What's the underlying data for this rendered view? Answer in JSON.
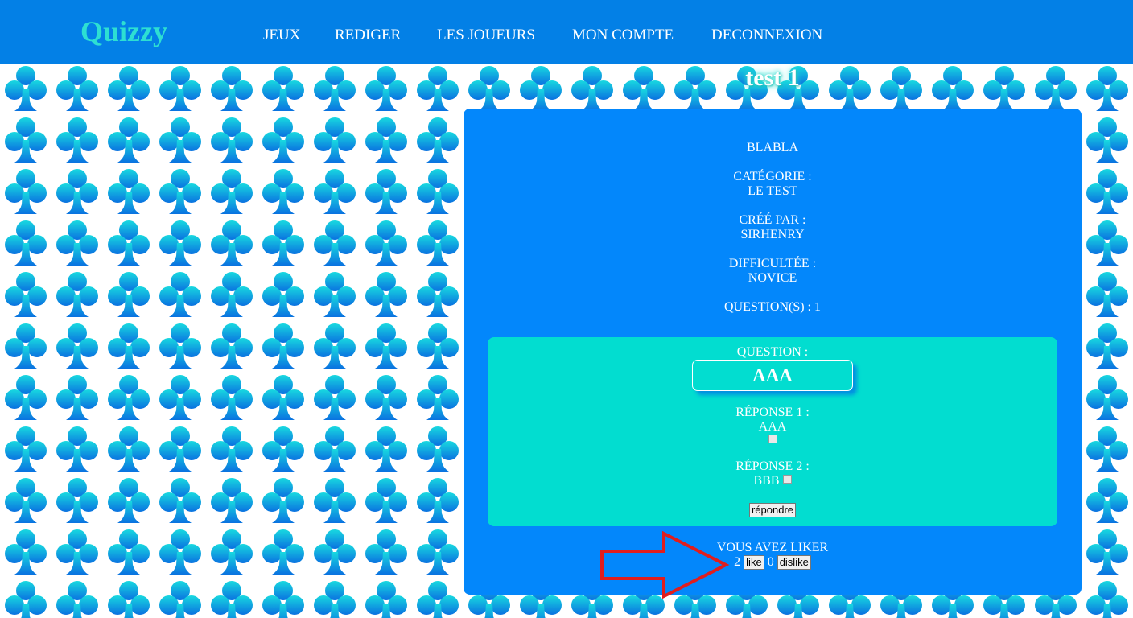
{
  "app": {
    "brand": "Quizzy"
  },
  "nav": {
    "items": [
      {
        "label": "JEUX"
      },
      {
        "label": "REDIGER"
      },
      {
        "label": "LES JOUEURS"
      },
      {
        "label": "MON COMPTE"
      },
      {
        "label": "DECONNEXION"
      }
    ]
  },
  "colors": {
    "navbar": "#0380e6",
    "brand": "#2ddfd2",
    "card": "#0387fb",
    "question_box": "#02ddd0",
    "arrow": "#e11d1d",
    "club_pattern_top": "#18d9e0",
    "club_pattern_bottom": "#0a72e0"
  },
  "background": {
    "icon": "club-suit-icon"
  },
  "quiz": {
    "title": "test 1",
    "description": "BLABLA",
    "category_label": "CATÉGORIE :",
    "category_value": "LE TEST",
    "created_by_label": "CRÉÉ PAR :",
    "created_by_value": "SIRHENRY",
    "difficulty_label": "DIFFICULTÉE :",
    "difficulty_value": "NOVICE",
    "questions_count": "QUESTION(S) : 1"
  },
  "question": {
    "label": "QUESTION :",
    "text": "AAA",
    "answers": [
      {
        "label": "RÉPONSE 1 :",
        "value": "AAA",
        "checked": false
      },
      {
        "label": "RÉPONSE 2 :",
        "value": "BBB",
        "checked": false
      }
    ],
    "submit_label": "répondre"
  },
  "votes": {
    "status": "VOUS AVEZ LIKER",
    "likes": "2",
    "like_label": "like",
    "dislikes": "0",
    "dislike_label": "dislike"
  },
  "annotation": {
    "icon": "right-arrow-icon"
  }
}
